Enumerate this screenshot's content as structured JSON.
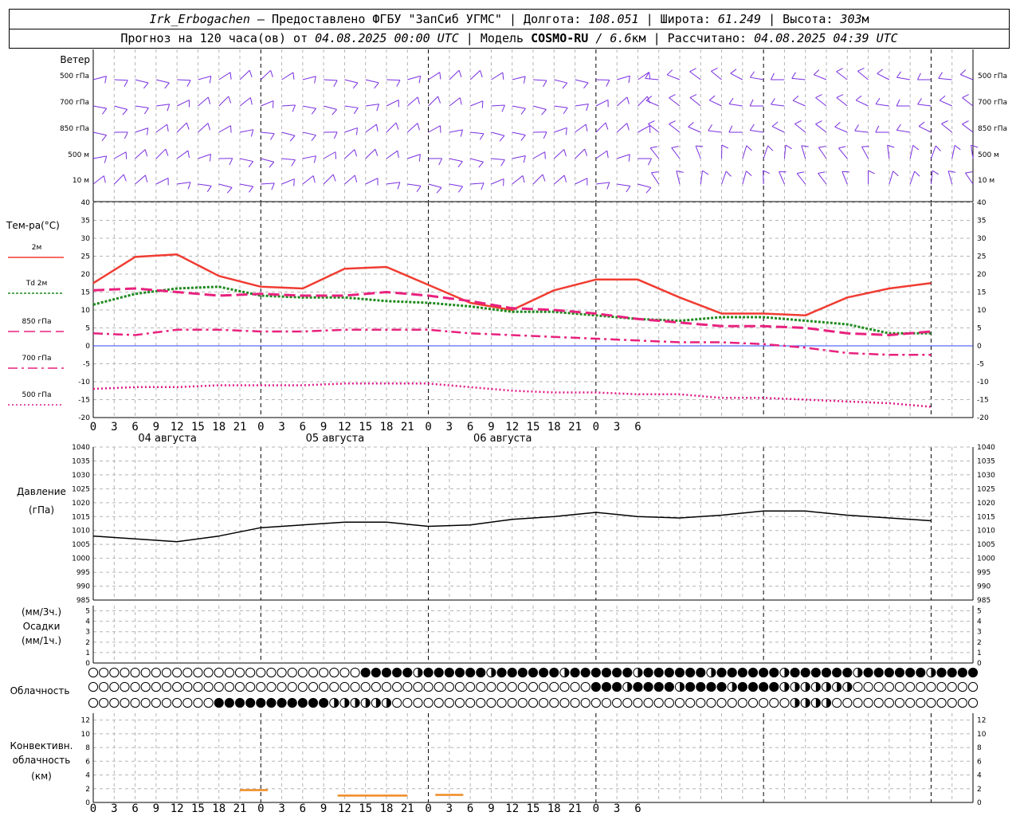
{
  "header": {
    "line1": {
      "station": "Irk_Erbogachen",
      "provider": " – Предоставлено ФГБУ \"ЗапСиб УГМС\" | Долгота: ",
      "lon": "108.051",
      "lat_label": " | Широта: ",
      "lat": "61.249",
      "alt_label": " | Высота: ",
      "alt": "303",
      "alt_unit": "м"
    },
    "line2": {
      "forecast_label": "Прогноз на 120 часа(ов) от ",
      "run_time": "04.08.2025 00:00 UTC",
      "model_label": "  | Модель ",
      "model": "COSMO-RU",
      "model_res": " / 6.6",
      "model_res_unit": "км",
      "calc_label": " | Рассчитано: ",
      "calc_time": "04.08.2025 04:39 UTC"
    }
  },
  "x_ticks": [
    "0",
    "3",
    "6",
    "9",
    "12",
    "15",
    "18",
    "21",
    "0",
    "3",
    "6",
    "9",
    "12",
    "15",
    "18",
    "21",
    "0",
    "3",
    "6",
    "9",
    "12",
    "15",
    "18",
    "21",
    "0",
    "3",
    "6"
  ],
  "days": [
    "04 августа",
    "05 августа",
    "06 августа"
  ],
  "wind_panel": {
    "title": "Ветер",
    "levels": [
      "500 гПа",
      "700 гПа",
      "850 гПа",
      "500 м",
      "10 м"
    ],
    "color": "#7a2ee0"
  },
  "temp_panel": {
    "title": "Тем-ра(°C)",
    "legend": [
      "2м",
      "Td 2м",
      "850 гПа",
      "700 гПа",
      "500 гПа"
    ],
    "yticks": [
      "40",
      "35",
      "30",
      "25",
      "20",
      "15",
      "10",
      "5",
      "0",
      "-5",
      "-10",
      "-15",
      "-20"
    ]
  },
  "pressure_panel": {
    "title": "Давление",
    "unit": "(гПа)",
    "yticks": [
      "1040",
      "1035",
      "1030",
      "1025",
      "1020",
      "1015",
      "1010",
      "1005",
      "1000",
      "995",
      "990",
      "985"
    ]
  },
  "precip_panel": {
    "label1": "(мм/3ч.)",
    "label2": "Осадки",
    "label3": "(мм/1ч.)",
    "yticks": [
      "5",
      "4",
      "3",
      "2",
      "1",
      "0"
    ]
  },
  "cloud_panel": {
    "title": "Облачность"
  },
  "conv_panel": {
    "label1": "Конвективн.",
    "label2": "облачность",
    "label3": "(км)",
    "yticks": [
      "12",
      "10",
      "8",
      "6",
      "4",
      "2",
      "0"
    ]
  },
  "chart_data": [
    {
      "type": "line",
      "title": "Тем-ра(°C)",
      "x_hours": [
        0,
        6,
        12,
        18,
        24,
        30,
        36,
        42,
        48,
        54,
        60,
        66,
        72,
        78,
        84,
        90,
        96,
        102,
        108,
        114,
        120
      ],
      "ylim": [
        -20,
        40
      ],
      "series": [
        {
          "name": "2м",
          "color": "#f03c32",
          "style": "solid",
          "values": [
            17.5,
            24.8,
            25.5,
            19.5,
            16.5,
            16.0,
            21.5,
            22.0,
            17.0,
            12.0,
            10.0,
            15.5,
            18.5,
            18.5,
            13.5,
            9.0,
            9.0,
            8.5,
            13.5,
            16.0,
            17.5
          ]
        },
        {
          "name": "Td 2м",
          "color": "#1d8a1d",
          "style": "dotted",
          "values": [
            11.5,
            14.5,
            16.0,
            16.5,
            14.0,
            13.5,
            13.5,
            12.5,
            12.0,
            11.0,
            9.5,
            9.5,
            8.5,
            7.5,
            7.0,
            8.0,
            8.0,
            7.0,
            6.0,
            3.5,
            3.5
          ]
        },
        {
          "name": "850 гПа",
          "color": "#e8217e",
          "style": "dashed",
          "values": [
            15.5,
            16.0,
            15.0,
            14.0,
            14.5,
            14.0,
            14.0,
            15.0,
            14.0,
            12.5,
            10.5,
            10.0,
            9.0,
            7.5,
            6.5,
            5.5,
            5.5,
            5.0,
            3.5,
            3.0,
            4.0
          ]
        },
        {
          "name": "700 гПа",
          "color": "#e8217e",
          "style": "dashdot",
          "values": [
            3.5,
            3.0,
            4.5,
            4.5,
            4.0,
            4.0,
            4.5,
            4.5,
            4.5,
            3.5,
            3.0,
            2.5,
            2.0,
            1.5,
            1.0,
            1.0,
            0.5,
            -0.5,
            -2.0,
            -2.5,
            -2.5
          ]
        },
        {
          "name": "500 гПа",
          "color": "#e01c8c",
          "style": "fine-dot",
          "values": [
            -12.0,
            -11.5,
            -11.5,
            -11.0,
            -11.0,
            -11.0,
            -10.5,
            -10.5,
            -10.5,
            -11.5,
            -12.5,
            -13.0,
            -13.0,
            -13.5,
            -13.5,
            -14.5,
            -14.5,
            -15.0,
            -15.5,
            -16.0,
            -17.0
          ]
        }
      ]
    },
    {
      "type": "line",
      "title": "Давление",
      "ylabel": "(гПа)",
      "ylim": [
        985,
        1040
      ],
      "x_hours": [
        0,
        6,
        12,
        18,
        24,
        30,
        36,
        42,
        48,
        54,
        60,
        66,
        72,
        78,
        84,
        90,
        96,
        102,
        108,
        114,
        120
      ],
      "series": [
        {
          "name": "Давление",
          "color": "#000000",
          "values": [
            1008,
            1007,
            1006,
            1008,
            1011,
            1012,
            1013,
            1013,
            1011.5,
            1012,
            1014,
            1015,
            1016.5,
            1015,
            1014.5,
            1015.5,
            1017,
            1017,
            1015.5,
            1014.5,
            1013.5
          ]
        }
      ]
    },
    {
      "type": "line",
      "title": "Конвективн. облачность",
      "ylabel": "(км)",
      "ylim": [
        0,
        13
      ],
      "segments": [
        {
          "x_start": 21,
          "x_end": 25,
          "y": 1.8
        },
        {
          "x_start": 35,
          "x_end": 45,
          "y": 1.0
        },
        {
          "x_start": 49,
          "x_end": 53,
          "y": 1.1
        }
      ],
      "color": "#f08a24"
    }
  ]
}
